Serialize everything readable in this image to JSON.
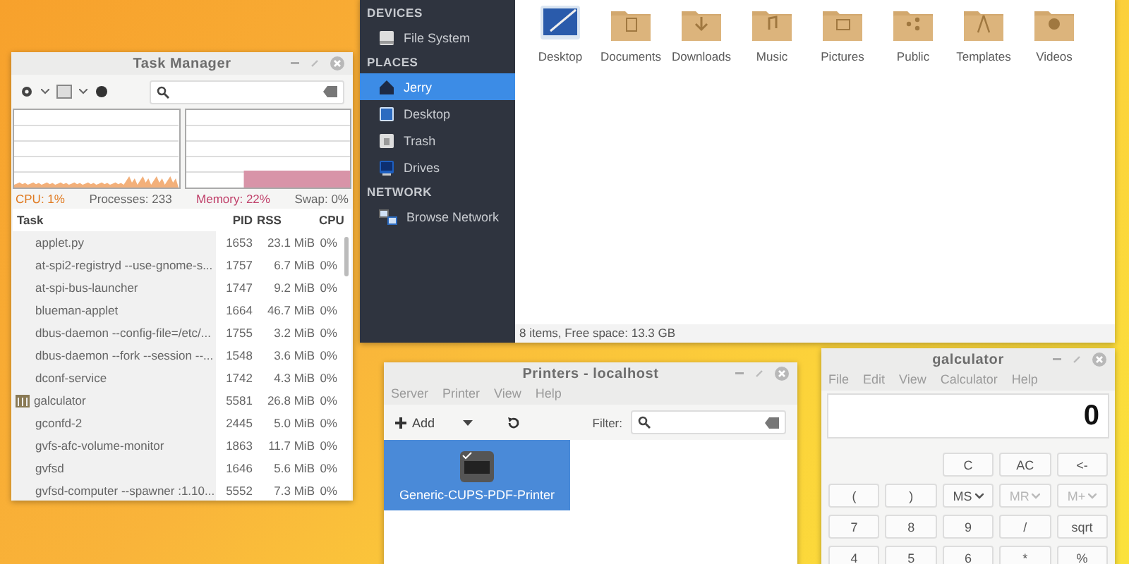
{
  "file_manager": {
    "sidebar": [
      {
        "heading": "DEVICES",
        "items": [
          {
            "label": "File System",
            "kind": "drive",
            "selected": false
          }
        ]
      },
      {
        "heading": "PLACES",
        "items": [
          {
            "label": "Jerry",
            "kind": "home",
            "selected": true
          },
          {
            "label": "Desktop",
            "kind": "desktop",
            "selected": false
          },
          {
            "label": "Trash",
            "kind": "trash",
            "selected": false
          },
          {
            "label": "Drives",
            "kind": "monitor",
            "selected": false
          }
        ]
      },
      {
        "heading": "NETWORK",
        "items": [
          {
            "label": "Browse Network",
            "kind": "network",
            "selected": false
          }
        ]
      }
    ],
    "folders": [
      {
        "label": "Desktop",
        "kind": "desktop"
      },
      {
        "label": "Documents",
        "kind": "document"
      },
      {
        "label": "Downloads",
        "kind": "download"
      },
      {
        "label": "Music",
        "kind": "music"
      },
      {
        "label": "Pictures",
        "kind": "picture"
      },
      {
        "label": "Public",
        "kind": "share"
      },
      {
        "label": "Templates",
        "kind": "compass"
      },
      {
        "label": "Videos",
        "kind": "video"
      }
    ],
    "status": "8 items, Free space: 13.3 GB"
  },
  "task_manager": {
    "title": "Task Manager",
    "cpu": "CPU: 1%",
    "processes": "Processes: 233",
    "memory": "Memory: 22%",
    "swap": "Swap: 0%",
    "columns": [
      "Task",
      "PID",
      "RSS",
      "CPU"
    ],
    "rows": [
      {
        "task": "applet.py",
        "pid": "1653",
        "rss": "23.1 MiB",
        "cpu": "0%",
        "kind": "process"
      },
      {
        "task": "at-spi2-registryd --use-gnome-s...",
        "pid": "1757",
        "rss": "6.7 MiB",
        "cpu": "0%",
        "kind": "process"
      },
      {
        "task": "at-spi-bus-launcher",
        "pid": "1747",
        "rss": "9.2 MiB",
        "cpu": "0%",
        "kind": "process"
      },
      {
        "task": "blueman-applet",
        "pid": "1664",
        "rss": "46.7 MiB",
        "cpu": "0%",
        "kind": "process"
      },
      {
        "task": "dbus-daemon --config-file=/etc/...",
        "pid": "1755",
        "rss": "3.2 MiB",
        "cpu": "0%",
        "kind": "process"
      },
      {
        "task": "dbus-daemon --fork --session --...",
        "pid": "1548",
        "rss": "3.6 MiB",
        "cpu": "0%",
        "kind": "process"
      },
      {
        "task": "dconf-service",
        "pid": "1742",
        "rss": "4.3 MiB",
        "cpu": "0%",
        "kind": "process"
      },
      {
        "task": "galculator",
        "pid": "5581",
        "rss": "26.8 MiB",
        "cpu": "0%",
        "kind": "app"
      },
      {
        "task": "gconfd-2",
        "pid": "2445",
        "rss": "5.0 MiB",
        "cpu": "0%",
        "kind": "process"
      },
      {
        "task": "gvfs-afc-volume-monitor",
        "pid": "1863",
        "rss": "11.7 MiB",
        "cpu": "0%",
        "kind": "process"
      },
      {
        "task": "gvfsd",
        "pid": "1646",
        "rss": "5.6 MiB",
        "cpu": "0%",
        "kind": "process"
      },
      {
        "task": "gvfsd-computer --spawner :1.10...",
        "pid": "5552",
        "rss": "7.3 MiB",
        "cpu": "0%",
        "kind": "process"
      }
    ]
  },
  "printers": {
    "title": "Printers - localhost",
    "menu": [
      "Server",
      "Printer",
      "View",
      "Help"
    ],
    "add": "Add",
    "filter": "Filter:",
    "items": [
      {
        "label": "Generic-CUPS-PDF-Printer",
        "selected": true
      }
    ]
  },
  "calculator": {
    "title": "galculator",
    "menu": [
      "File",
      "Edit",
      "View",
      "Calculator",
      "Help"
    ],
    "display": "0",
    "rows": [
      [
        null,
        null,
        {
          "label": "C",
          "kind": "plain",
          "disabled": false
        },
        {
          "label": "AC",
          "kind": "plain",
          "disabled": false
        },
        {
          "label": "<-",
          "kind": "plain",
          "disabled": false
        }
      ],
      [
        {
          "label": "(",
          "kind": "plain",
          "disabled": false
        },
        {
          "label": ")",
          "kind": "plain",
          "disabled": false
        },
        {
          "label": "MS",
          "kind": "dropdown",
          "disabled": false
        },
        {
          "label": "MR",
          "kind": "dropdown",
          "disabled": true
        },
        {
          "label": "M+",
          "kind": "dropdown",
          "disabled": true
        }
      ],
      [
        {
          "label": "7",
          "kind": "plain",
          "disabled": false
        },
        {
          "label": "8",
          "kind": "plain",
          "disabled": false
        },
        {
          "label": "9",
          "kind": "plain",
          "disabled": false
        },
        {
          "label": "/",
          "kind": "plain",
          "disabled": false
        },
        {
          "label": "sqrt",
          "kind": "plain",
          "disabled": false
        }
      ],
      [
        {
          "label": "4",
          "kind": "plain",
          "disabled": false
        },
        {
          "label": "5",
          "kind": "plain",
          "disabled": false
        },
        {
          "label": "6",
          "kind": "plain",
          "disabled": false
        },
        {
          "label": "*",
          "kind": "plain",
          "disabled": false
        },
        {
          "label": "%",
          "kind": "plain",
          "disabled": false
        }
      ]
    ]
  }
}
